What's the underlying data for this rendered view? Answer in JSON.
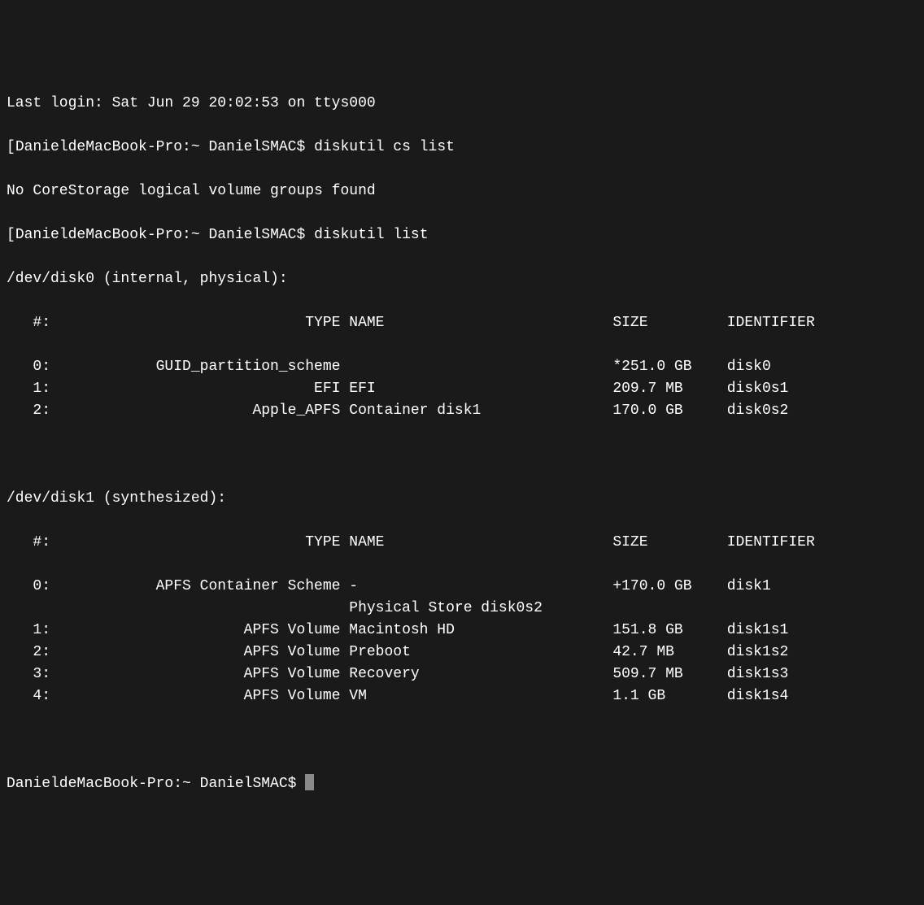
{
  "terminal": {
    "last_login": "Last login: Sat Jun 29 20:02:53 on ttys000",
    "prompt_prefix": "DanieldeMacBook-Pro:~ DanielSMAC$",
    "commands": {
      "cs_list": "diskutil cs list",
      "cs_list_output": "No CoreStorage logical volume groups found",
      "list": "diskutil list"
    },
    "disk0": {
      "header": "/dev/disk0 (internal, physical):",
      "col_headers": {
        "num": "#:",
        "type": "TYPE",
        "name": "NAME",
        "size": "SIZE",
        "identifier": "IDENTIFIER"
      },
      "rows": [
        {
          "num": "0:",
          "type": "GUID_partition_scheme",
          "name": "",
          "size": "*251.0 GB",
          "identifier": "disk0"
        },
        {
          "num": "1:",
          "type": "EFI",
          "name": "EFI",
          "size": "209.7 MB",
          "identifier": "disk0s1"
        },
        {
          "num": "2:",
          "type": "Apple_APFS",
          "name": "Container disk1",
          "size": "170.0 GB",
          "identifier": "disk0s2"
        }
      ]
    },
    "disk1": {
      "header": "/dev/disk1 (synthesized):",
      "col_headers": {
        "num": "#:",
        "type": "TYPE",
        "name": "NAME",
        "size": "SIZE",
        "identifier": "IDENTIFIER"
      },
      "rows": [
        {
          "num": "0:",
          "type": "APFS Container Scheme",
          "name": "-",
          "size": "+170.0 GB",
          "identifier": "disk1"
        },
        {
          "extra": "Physical Store disk0s2"
        },
        {
          "num": "1:",
          "type": "APFS Volume",
          "name": "Macintosh HD",
          "size": "151.8 GB",
          "identifier": "disk1s1"
        },
        {
          "num": "2:",
          "type": "APFS Volume",
          "name": "Preboot",
          "size": "42.7 MB",
          "identifier": "disk1s2"
        },
        {
          "num": "3:",
          "type": "APFS Volume",
          "name": "Recovery",
          "size": "509.7 MB",
          "identifier": "disk1s3"
        },
        {
          "num": "4:",
          "type": "APFS Volume",
          "name": "VM",
          "size": "1.1 GB",
          "identifier": "disk1s4"
        }
      ]
    },
    "final_prompt": "DanieldeMacBook-Pro:~ DanielSMAC$ "
  }
}
